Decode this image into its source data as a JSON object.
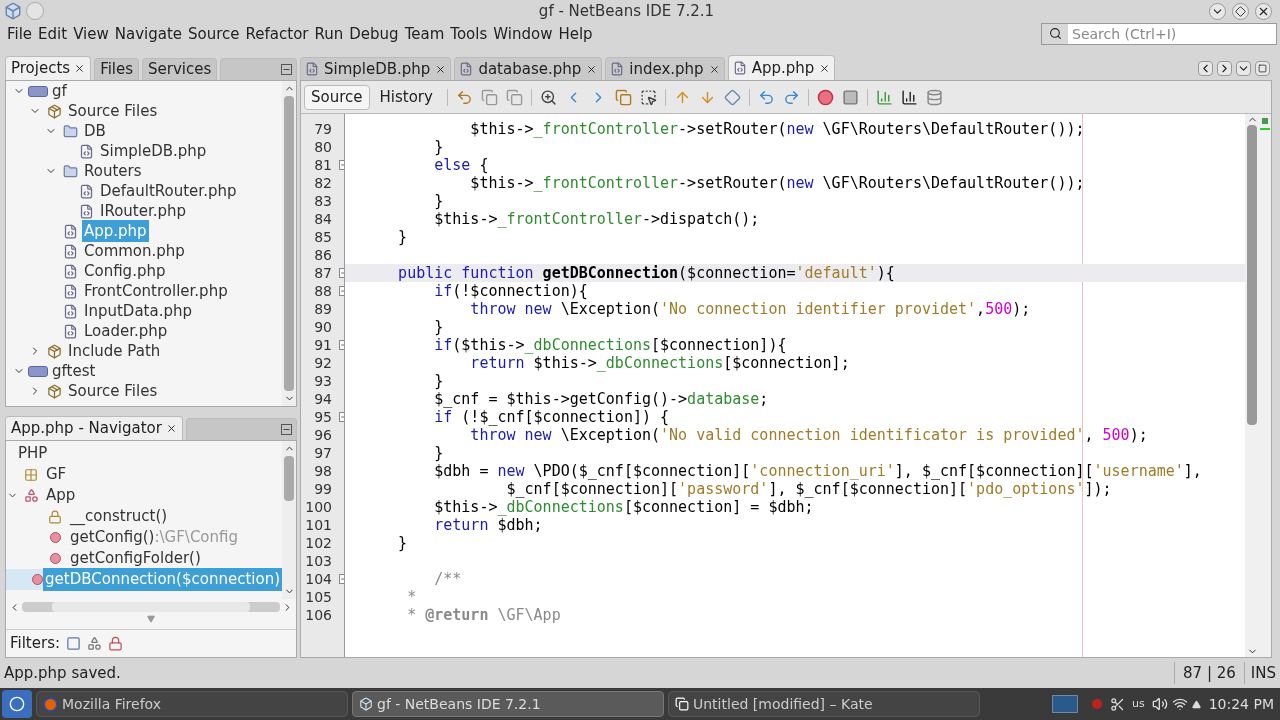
{
  "window": {
    "title": "gf - NetBeans IDE 7.2.1"
  },
  "menu": [
    "File",
    "Edit",
    "View",
    "Navigate",
    "Source",
    "Refactor",
    "Run",
    "Debug",
    "Team",
    "Tools",
    "Window",
    "Help"
  ],
  "search": {
    "placeholder": "Search (Ctrl+I)"
  },
  "left_tabs": [
    {
      "label": "Projects",
      "selected": true
    },
    {
      "label": "Files",
      "selected": false
    },
    {
      "label": "Services",
      "selected": false
    }
  ],
  "projects": [
    {
      "label": "gf",
      "kind": "project",
      "expanded": true,
      "selected": false,
      "children": [
        {
          "label": "Source Files",
          "kind": "package",
          "expanded": true,
          "selected": false,
          "children": [
            {
              "label": "DB",
              "kind": "folder",
              "expanded": true,
              "selected": false,
              "children": [
                {
                  "label": "SimpleDB.php",
                  "kind": "file",
                  "selected": false
                }
              ]
            },
            {
              "label": "Routers",
              "kind": "folder",
              "expanded": true,
              "selected": false,
              "children": [
                {
                  "label": "DefaultRouter.php",
                  "kind": "file",
                  "selected": false
                },
                {
                  "label": "IRouter.php",
                  "kind": "file",
                  "selected": false
                }
              ]
            },
            {
              "label": "App.php",
              "kind": "file",
              "selected": true
            },
            {
              "label": "Common.php",
              "kind": "file",
              "selected": false
            },
            {
              "label": "Config.php",
              "kind": "file",
              "selected": false
            },
            {
              "label": "FrontController.php",
              "kind": "file",
              "selected": false
            },
            {
              "label": "InputData.php",
              "kind": "file",
              "selected": false
            },
            {
              "label": "Loader.php",
              "kind": "file",
              "selected": false
            }
          ]
        },
        {
          "label": "Include Path",
          "kind": "package",
          "expanded": false,
          "selected": false
        }
      ]
    },
    {
      "label": "gftest",
      "kind": "project",
      "expanded": true,
      "selected": false,
      "children": [
        {
          "label": "Source Files",
          "kind": "package",
          "expanded": false,
          "selected": false
        }
      ]
    }
  ],
  "navigator": {
    "title": "App.php - Navigator",
    "heading": "PHP",
    "items": [
      {
        "label": "GF",
        "kind": "namespace",
        "selected": false
      },
      {
        "label": "App",
        "kind": "class",
        "expanded": true,
        "selected": false,
        "children": [
          {
            "label": "__construct()",
            "kind": "constructor",
            "selected": false
          },
          {
            "label": "getConfig()",
            "suffix": ":\\GF\\Config",
            "kind": "method",
            "selected": false
          },
          {
            "label": "getConfigFolder()",
            "kind": "method",
            "selected": false
          },
          {
            "label": "getDBConnection($connection)",
            "kind": "method",
            "selected": true
          }
        ]
      }
    ],
    "filters_label": "Filters:"
  },
  "editor_tabs": [
    {
      "label": "SimpleDB.php",
      "selected": false
    },
    {
      "label": "database.php",
      "selected": false
    },
    {
      "label": "index.php",
      "selected": false
    },
    {
      "label": "App.php",
      "selected": true
    }
  ],
  "view_tabs": [
    {
      "label": "Source",
      "selected": true
    },
    {
      "label": "History",
      "selected": false
    }
  ],
  "code": [
    {
      "number": "79",
      "kind": "plain",
      "current": false,
      "tokens": [
        {
          "kind": "p",
          "text": "            $this->"
        },
        {
          "kind": "fld",
          "text": "_frontController"
        },
        {
          "kind": "p",
          "text": "->setRouter("
        },
        {
          "kind": "kw",
          "text": "new"
        },
        {
          "kind": "p",
          "text": " \\GF\\Routers\\DefaultRouter());"
        }
      ]
    },
    {
      "number": "80",
      "kind": "fold-end",
      "current": false,
      "tokens": [
        {
          "kind": "p",
          "text": "        }"
        }
      ]
    },
    {
      "number": "81",
      "kind": "fold-start",
      "current": false,
      "tokens": [
        {
          "kind": "kw",
          "text": "        else"
        },
        {
          "kind": "p",
          "text": " {"
        }
      ]
    },
    {
      "number": "82",
      "kind": "plain",
      "current": false,
      "tokens": [
        {
          "kind": "p",
          "text": "            $this->"
        },
        {
          "kind": "fld",
          "text": "_frontController"
        },
        {
          "kind": "p",
          "text": "->setRouter("
        },
        {
          "kind": "kw",
          "text": "new"
        },
        {
          "kind": "p",
          "text": " \\GF\\Routers\\DefaultRouter());"
        }
      ]
    },
    {
      "number": "83",
      "kind": "fold-end",
      "current": false,
      "tokens": [
        {
          "kind": "p",
          "text": "        }"
        }
      ]
    },
    {
      "number": "84",
      "kind": "plain",
      "current": false,
      "tokens": [
        {
          "kind": "p",
          "text": "        $this->"
        },
        {
          "kind": "fld",
          "text": "_frontController"
        },
        {
          "kind": "p",
          "text": "->dispatch();"
        }
      ]
    },
    {
      "number": "85",
      "kind": "fold-end",
      "current": false,
      "tokens": [
        {
          "kind": "p",
          "text": "    }"
        }
      ]
    },
    {
      "number": "86",
      "kind": "plain",
      "current": false
    },
    {
      "number": "87",
      "kind": "fold-start",
      "current": true,
      "tokens": [
        {
          "kind": "kw",
          "text": "    public function"
        },
        {
          "kind": "bold",
          "text": " getDBConnection"
        },
        {
          "kind": "p",
          "text": "($connection="
        },
        {
          "kind": "str",
          "text": "'default'"
        },
        {
          "kind": "p",
          "text": "){"
        }
      ]
    },
    {
      "number": "88",
      "kind": "fold-start",
      "current": false,
      "tokens": [
        {
          "kind": "kw",
          "text": "        if"
        },
        {
          "kind": "p",
          "text": "(!$connection){"
        }
      ]
    },
    {
      "number": "89",
      "kind": "plain",
      "current": false,
      "tokens": [
        {
          "kind": "kw",
          "text": "            throw new"
        },
        {
          "kind": "p",
          "text": " \\Exception("
        },
        {
          "kind": "str",
          "text": "'No connection identifier providet'"
        },
        {
          "kind": "p",
          "text": ","
        },
        {
          "kind": "num",
          "text": "500"
        },
        {
          "kind": "p",
          "text": ");"
        }
      ]
    },
    {
      "number": "90",
      "kind": "fold-end",
      "current": false,
      "tokens": [
        {
          "kind": "p",
          "text": "        }"
        }
      ]
    },
    {
      "number": "91",
      "kind": "fold-start",
      "current": false,
      "tokens": [
        {
          "kind": "kw",
          "text": "        if"
        },
        {
          "kind": "p",
          "text": "($this->"
        },
        {
          "kind": "fld",
          "text": "_dbConnections"
        },
        {
          "kind": "p",
          "text": "[$connection]){"
        }
      ]
    },
    {
      "number": "92",
      "kind": "plain",
      "current": false,
      "tokens": [
        {
          "kind": "kw",
          "text": "            return"
        },
        {
          "kind": "p",
          "text": " $this->"
        },
        {
          "kind": "fld",
          "text": "_dbConnections"
        },
        {
          "kind": "p",
          "text": "[$connection];"
        }
      ]
    },
    {
      "number": "93",
      "kind": "fold-end",
      "current": false,
      "tokens": [
        {
          "kind": "p",
          "text": "        }"
        }
      ]
    },
    {
      "number": "94",
      "kind": "plain",
      "current": false,
      "tokens": [
        {
          "kind": "p",
          "text": "        $_cnf = $this->getConfig()->"
        },
        {
          "kind": "fld",
          "text": "database"
        },
        {
          "kind": "p",
          "text": ";"
        }
      ]
    },
    {
      "number": "95",
      "kind": "fold-start",
      "current": false,
      "tokens": [
        {
          "kind": "kw",
          "text": "        if"
        },
        {
          "kind": "p",
          "text": " (!$_cnf[$connection]) {"
        }
      ]
    },
    {
      "number": "96",
      "kind": "plain",
      "current": false,
      "tokens": [
        {
          "kind": "kw",
          "text": "            throw new"
        },
        {
          "kind": "p",
          "text": " \\Exception("
        },
        {
          "kind": "str",
          "text": "'No valid connection identificator is provided'"
        },
        {
          "kind": "p",
          "text": ", "
        },
        {
          "kind": "num",
          "text": "500"
        },
        {
          "kind": "p",
          "text": ");"
        }
      ]
    },
    {
      "number": "97",
      "kind": "fold-end",
      "current": false,
      "tokens": [
        {
          "kind": "p",
          "text": "        }"
        }
      ]
    },
    {
      "number": "98",
      "kind": "plain",
      "current": false,
      "tokens": [
        {
          "kind": "p",
          "text": "        $dbh = "
        },
        {
          "kind": "kw",
          "text": "new"
        },
        {
          "kind": "p",
          "text": " \\PDO($_cnf[$connection]["
        },
        {
          "kind": "str",
          "text": "'connection_uri'"
        },
        {
          "kind": "p",
          "text": "], $_cnf[$connection]["
        },
        {
          "kind": "str",
          "text": "'username'"
        },
        {
          "kind": "p",
          "text": "],"
        }
      ]
    },
    {
      "number": "99",
      "kind": "plain",
      "current": false,
      "tokens": [
        {
          "kind": "p",
          "text": "                $_cnf[$connection]["
        },
        {
          "kind": "str",
          "text": "'password'"
        },
        {
          "kind": "p",
          "text": "], $_cnf[$connection]["
        },
        {
          "kind": "str",
          "text": "'pdo_options'"
        },
        {
          "kind": "p",
          "text": "]);"
        }
      ]
    },
    {
      "number": "100",
      "kind": "plain",
      "current": false,
      "tokens": [
        {
          "kind": "p",
          "text": "        $this->"
        },
        {
          "kind": "fld",
          "text": "_dbConnections"
        },
        {
          "kind": "p",
          "text": "[$connection] = $dbh;"
        }
      ]
    },
    {
      "number": "101",
      "kind": "plain",
      "current": false,
      "tokens": [
        {
          "kind": "kw",
          "text": "        return"
        },
        {
          "kind": "p",
          "text": " $dbh;"
        }
      ]
    },
    {
      "number": "102",
      "kind": "fold-end",
      "current": false,
      "tokens": [
        {
          "kind": "p",
          "text": "    }"
        }
      ]
    },
    {
      "number": "103",
      "kind": "plain",
      "current": false
    },
    {
      "number": "104",
      "kind": "fold-start",
      "current": false,
      "tokens": [
        {
          "kind": "cmt",
          "text": "        /**"
        }
      ]
    },
    {
      "number": "105",
      "kind": "plain",
      "current": false,
      "tokens": [
        {
          "kind": "cmt",
          "text": "     *"
        }
      ]
    },
    {
      "number": "106",
      "kind": "plain",
      "current": false,
      "tokens": [
        {
          "kind": "cmt",
          "text": "     * "
        },
        {
          "kind": "cmtb",
          "text": "@return"
        },
        {
          "kind": "cmt",
          "text": " \\GF\\App"
        }
      ]
    }
  ],
  "status_bar": {
    "message": "App.php saved.",
    "position": "87 | 26",
    "mode": "INS"
  },
  "taskbar": {
    "windows": [
      {
        "label": "Mozilla Firefox",
        "kind": "firefox",
        "selected": false
      },
      {
        "label": "gf - NetBeans IDE 7.2.1",
        "kind": "netbeans",
        "selected": true
      },
      {
        "label": "Untitled [modified] – Kate",
        "kind": "kate",
        "selected": false
      }
    ],
    "keyboard": "us",
    "clock": "10:24 PM"
  }
}
